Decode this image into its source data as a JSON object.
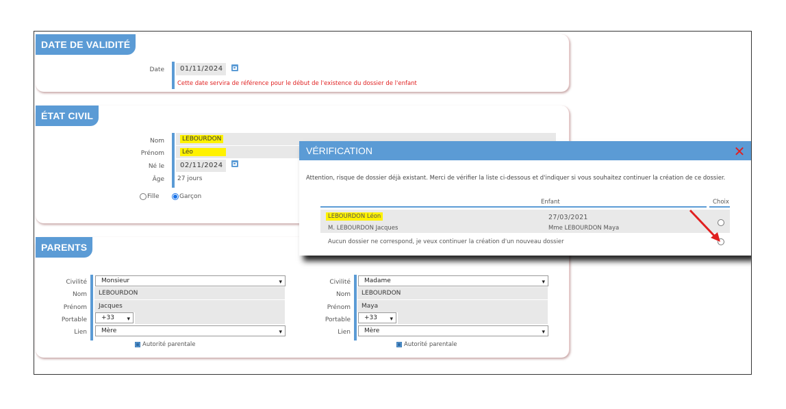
{
  "validity": {
    "title": "DATE DE VALIDITÉ",
    "date_label": "Date",
    "date_value": "01/11/2024",
    "note": "Cette date servira de référence pour le début de l'existence du dossier de l'enfant"
  },
  "civil": {
    "title": "ÉTAT CIVIL",
    "nom_label": "Nom",
    "nom_value": "LEBOURDON",
    "prenom_label": "Prénom",
    "prenom_value": "Léo",
    "ne_label": "Né le",
    "ne_value": "02/11/2024",
    "age_label": "Âge",
    "age_value": "27 jours",
    "fille_label": "Fille",
    "garcon_label": "Garçon",
    "selected_gender": "Garçon"
  },
  "parents": {
    "title": "PARENTS",
    "labels": {
      "civilite": "Civilité",
      "nom": "Nom",
      "prenom": "Prénom",
      "portable": "Portable",
      "lien": "Lien",
      "autorite": "Autorité parentale"
    },
    "parent1": {
      "civilite": "Monsieur",
      "nom": "LEBOURDON",
      "prenom": "Jacques",
      "portable_code": "+33",
      "lien": "Mère"
    },
    "parent2": {
      "civilite": "Madame",
      "nom": "LEBOURDON",
      "prenom": "Maya",
      "portable_code": "+33",
      "lien": "Mère"
    }
  },
  "dialog": {
    "title": "VÉRIFICATION",
    "close_icon": "close-x-icon",
    "message": "Attention, risque de dossier déjà existant. Merci de vérifier la liste ci-dessous et d'indiquer si vous souhaitez continuer la création de ce dossier.",
    "col_enfant": "Enfant",
    "col_choix": "Choix",
    "match": {
      "child_name": "LEBOURDON Léon",
      "birth_date": "27/03/2021",
      "father": "M. LEBOURDON Jacques",
      "mother": "Mme LEBOURDON Maya"
    },
    "no_match_text": "Aucun dossier ne correspond, je veux continuer la création d'un nouveau dossier"
  },
  "colors": {
    "accent": "#5b9bd5",
    "highlight": "#fff200",
    "warning_text": "#e02020",
    "annotation_arrow": "#e02020"
  }
}
